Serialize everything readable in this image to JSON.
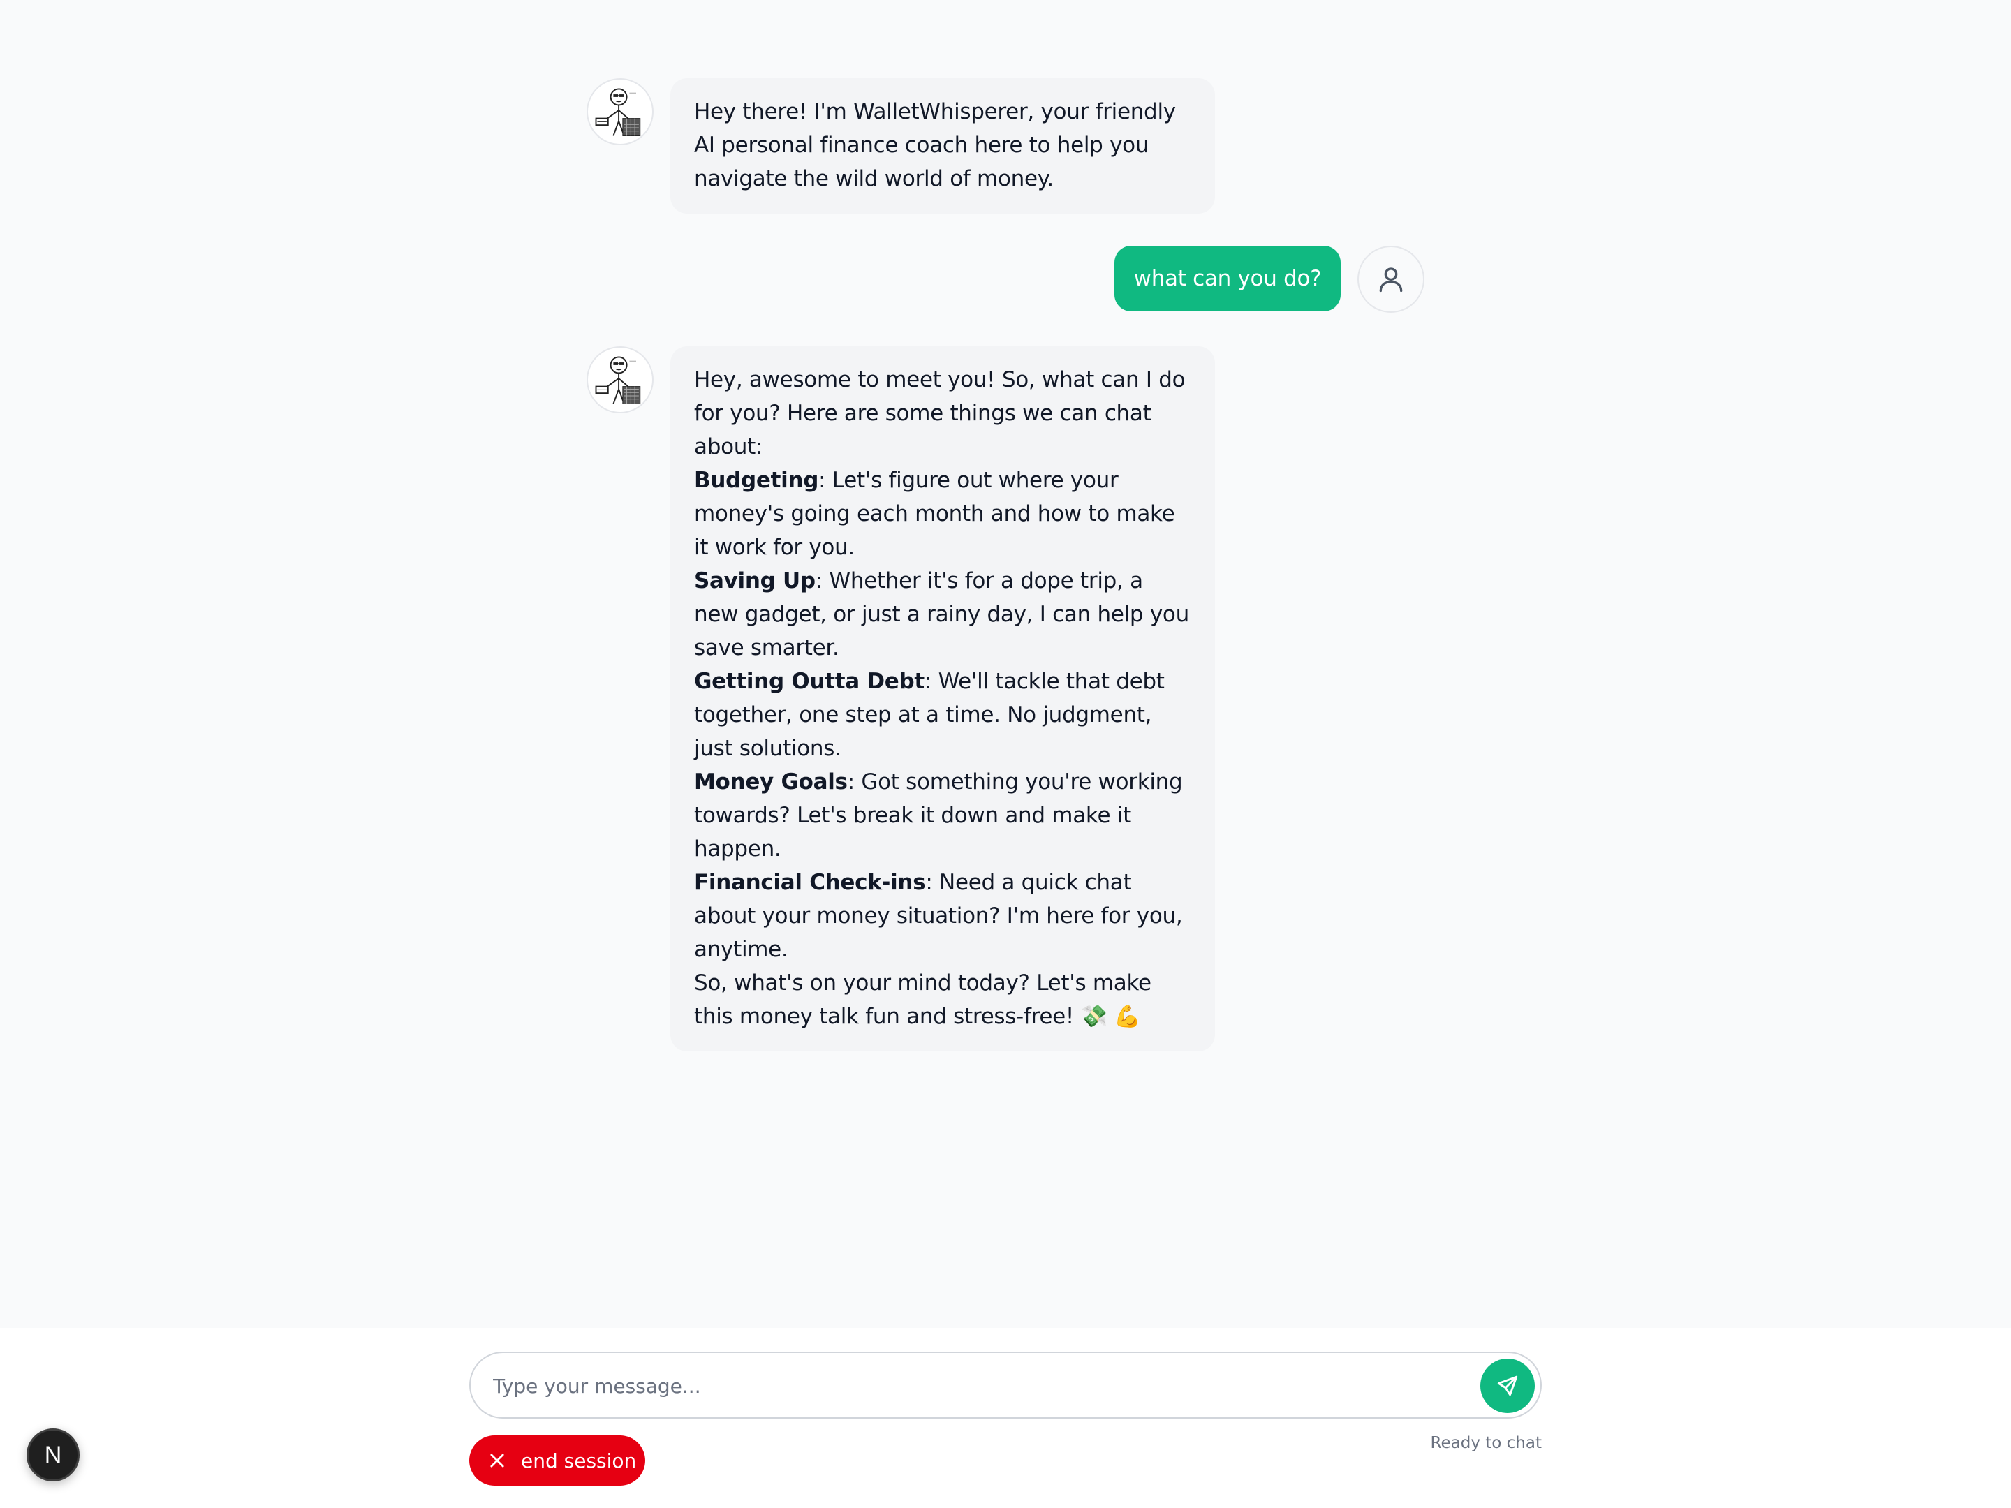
{
  "assistant": {
    "name": "WalletWhisperer",
    "avatar_icon": "stick-figure-money-avatar-icon"
  },
  "messages": [
    {
      "role": "assistant",
      "text": "Hey there! I'm WalletWhisperer, your friendly AI personal finance coach here to help you navigate the wild world of money."
    },
    {
      "role": "user",
      "text": "what can you do?",
      "avatar_icon": "user-icon"
    },
    {
      "role": "assistant",
      "intro": "Hey, awesome to meet you! So, what can I do for you? Here are some things we can chat about:",
      "items": [
        {
          "title": "Budgeting",
          "text": ": Let's figure out where your money's going each month and how to make it work for you."
        },
        {
          "title": "Saving Up",
          "text": ": Whether it's for a dope trip, a new gadget, or just a rainy day, I can help you save smarter."
        },
        {
          "title": "Getting Outta Debt",
          "text": ": We'll tackle that debt together, one step at a time. No judgment, just solutions."
        },
        {
          "title": "Money Goals",
          "text": ": Got something you're working towards? Let's break it down and make it happen."
        },
        {
          "title": "Financial Check-ins",
          "text": ": Need a quick chat about your money situation? I'm here for you, anytime."
        }
      ],
      "outro": "So, what's on your mind today? Let's make this money talk fun and stress-free! 💸 💪"
    }
  ],
  "composer": {
    "placeholder": "Type your message...",
    "value": "",
    "send_icon": "send-icon"
  },
  "end_session": {
    "label": "end session",
    "icon": "close-icon"
  },
  "status": "Ready to chat",
  "dev_badge": {
    "label": "N",
    "icon": "nextjs-logo-icon"
  },
  "colors": {
    "accent": "#10b981",
    "danger": "#e60012",
    "bubble_bg": "#f3f4f6",
    "page_bg": "#f9fafb"
  }
}
